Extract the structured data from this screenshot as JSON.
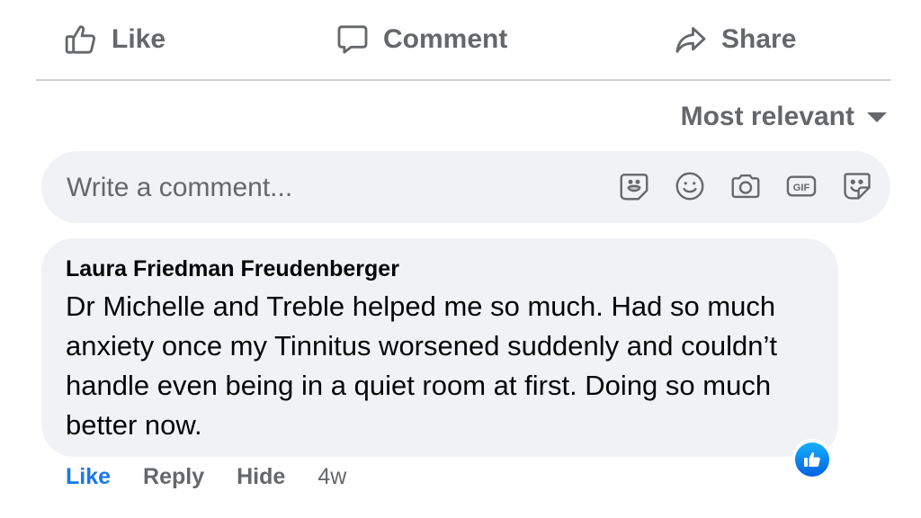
{
  "actions": {
    "like_label": "Like",
    "comment_label": "Comment",
    "share_label": "Share"
  },
  "sort": {
    "label": "Most relevant"
  },
  "composer": {
    "placeholder": "Write a comment...",
    "icons": [
      "avatar-sticker-icon",
      "emoji-icon",
      "camera-icon",
      "gif-icon",
      "sticker-icon"
    ]
  },
  "comment": {
    "author": "Laura Friedman Freudenberger",
    "text": "Dr Michelle and Treble helped me so much. Had so much anxiety once my Tinnitus worsened suddenly and couldn’t handle even being in a quiet room at first. Doing so much better now.",
    "reaction": "like",
    "actions": {
      "like": "Like",
      "reply": "Reply",
      "hide": "Hide"
    },
    "time": "4w"
  },
  "colors": {
    "text_secondary": "#65676b",
    "accent": "#1877f2",
    "bubble_bg": "#f0f2f5"
  }
}
